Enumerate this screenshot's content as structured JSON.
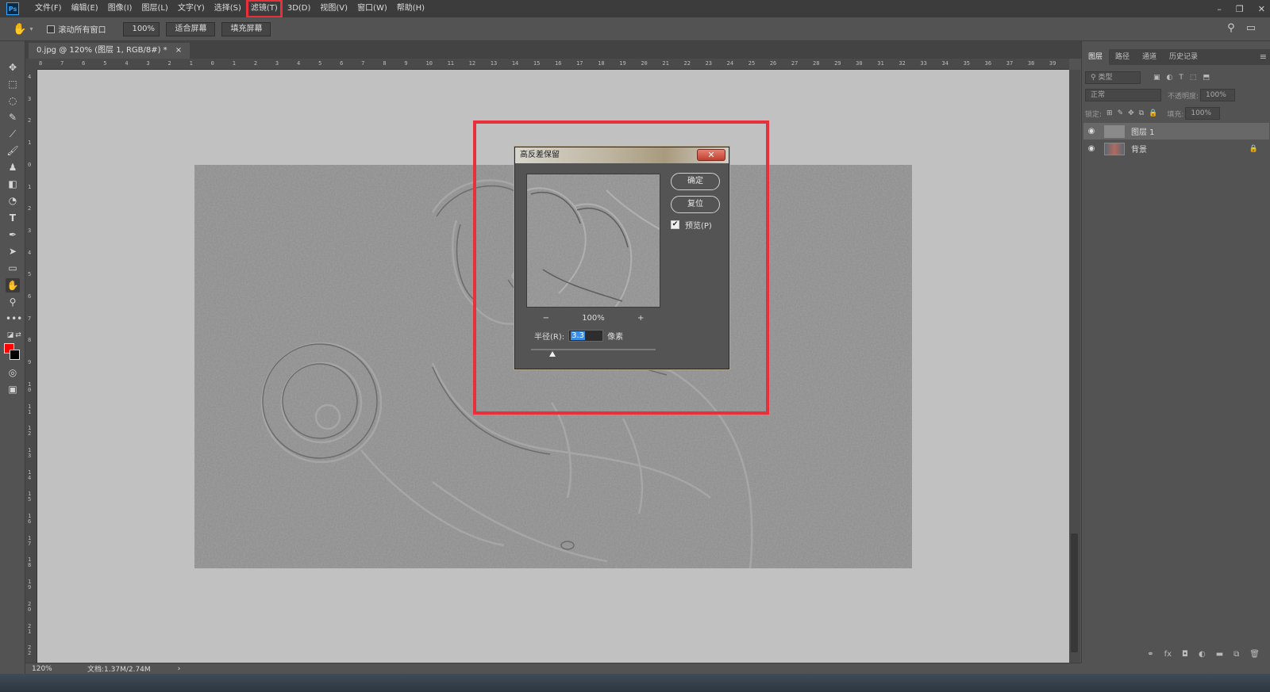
{
  "menubar": {
    "logo": "Ps",
    "items": [
      "文件(F)",
      "编辑(E)",
      "图像(I)",
      "图层(L)",
      "文字(Y)",
      "选择(S)",
      "滤镜(T)",
      "3D(D)",
      "视图(V)",
      "窗口(W)",
      "帮助(H)"
    ],
    "highlighted_index": 6,
    "window_controls": [
      "–",
      "❐",
      "✕"
    ]
  },
  "options": {
    "scroll_all_label": "滚动所有窗口",
    "zoom_value": "100%",
    "fit_screen_label": "适合屏幕",
    "fill_screen_label": "填充屏幕"
  },
  "document": {
    "tab_title": "0.jpg @ 120% (图层 1, RGB/8#) *",
    "tab_close": "×",
    "zoom": "120%",
    "doc_size": "文档:1.37M/2.74M",
    "status_arrow": "›"
  },
  "ruler": {
    "h_labels": [
      "8",
      "7",
      "6",
      "5",
      "4",
      "3",
      "2",
      "1",
      "0",
      "1",
      "2",
      "3",
      "4",
      "5",
      "6",
      "7",
      "8",
      "9",
      "10",
      "11",
      "12",
      "13",
      "14",
      "15",
      "16",
      "17",
      "18",
      "19",
      "20",
      "21",
      "22",
      "23",
      "24",
      "25",
      "26",
      "27",
      "28",
      "29",
      "30",
      "31",
      "32",
      "33",
      "34",
      "35",
      "36",
      "37",
      "38",
      "39"
    ],
    "v_labels": [
      "4",
      "3",
      "2",
      "1",
      "0",
      "1",
      "2",
      "3",
      "4",
      "5",
      "6",
      "7",
      "8",
      "9",
      "10",
      "11",
      "12",
      "13",
      "14",
      "15",
      "16",
      "17",
      "18",
      "19",
      "20",
      "21",
      "22"
    ]
  },
  "dialog": {
    "title": "高反差保留",
    "close": "✕",
    "ok_label": "确定",
    "reset_label": "复位",
    "preview_label": "预览(P)",
    "preview_checked": true,
    "zoom_percent": "100%",
    "zoom_out_icon": "−",
    "zoom_in_icon": "+",
    "radius_label": "半径(R):",
    "radius_value": "3.3",
    "radius_unit": "像素",
    "slider_fraction": 0.17
  },
  "panel": {
    "tabs": [
      "图层",
      "路径",
      "通道",
      "历史记录"
    ],
    "active_tab": 0,
    "menu_icon": "≡",
    "filter_placeholder": "类型",
    "blend_mode": "正常",
    "opacity_label": "不透明度:",
    "opacity_value": "100%",
    "lock_label": "锁定:",
    "fill_label": "填充:",
    "fill_value": "100%",
    "layers": [
      {
        "name": "图层 1",
        "selected": true,
        "locked": false
      },
      {
        "name": "背景",
        "selected": false,
        "locked": true
      }
    ]
  },
  "colors": {
    "foreground": "#ff0000",
    "background": "#000000",
    "highlight": "#e8303a"
  }
}
